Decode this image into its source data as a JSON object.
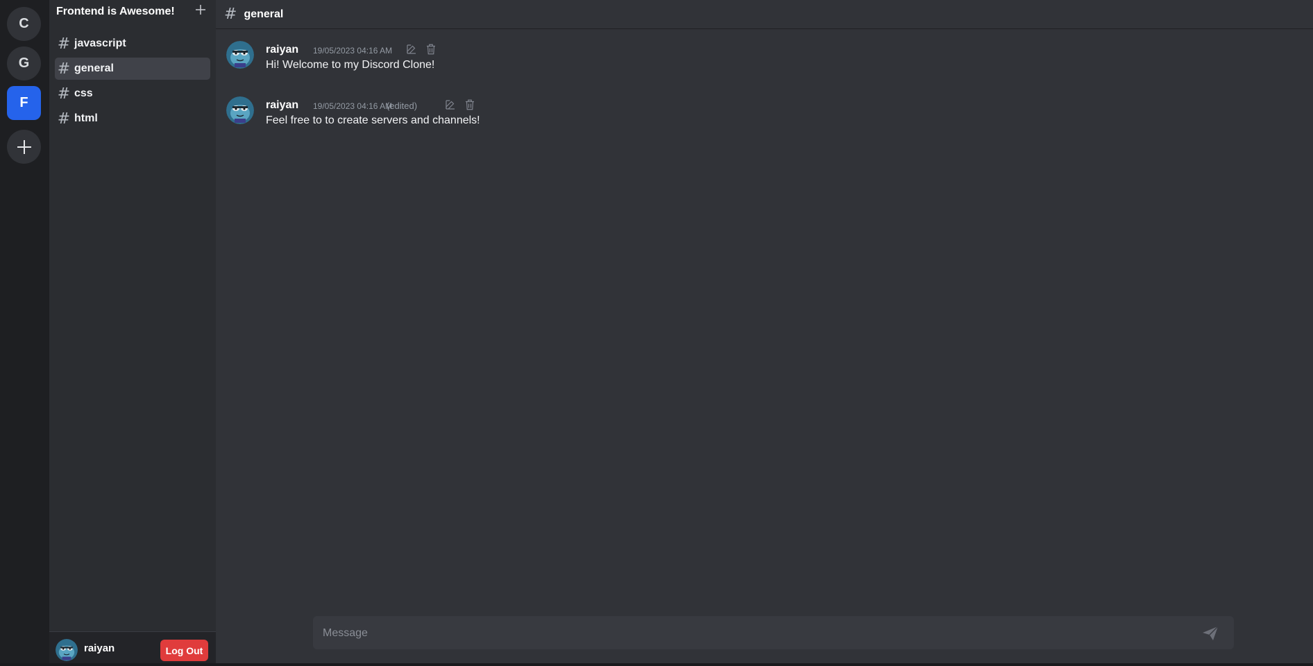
{
  "servers": [
    {
      "initial": "C"
    },
    {
      "initial": "G"
    },
    {
      "initial": "F",
      "active": true
    }
  ],
  "server": {
    "name": "Frontend is Awesome!"
  },
  "channels": [
    {
      "name": "javascript"
    },
    {
      "name": "general",
      "active": true
    },
    {
      "name": "css"
    },
    {
      "name": "html"
    }
  ],
  "header": {
    "hash": "#",
    "channel": "general"
  },
  "messages": [
    {
      "author": "raiyan",
      "time": "19/05/2023 04:16 AM",
      "edited": "",
      "text": "Hi! Welcome to my Discord Clone!"
    },
    {
      "author": "raiyan",
      "time": "19/05/2023 04:16 AM",
      "edited": "(edited)",
      "text": "Feel free to to create servers and channels!"
    }
  ],
  "composer": {
    "placeholder": "Message"
  },
  "user": {
    "name": "raiyan",
    "logout_label": "Log Out"
  },
  "colors": {
    "accent": "#2563eb",
    "danger": "#e03c3c",
    "bg_main": "#313338",
    "bg_sidebar": "#2b2d31",
    "bg_rail": "#1e1f22"
  },
  "icons": {
    "add_server": "plus-icon",
    "add_channel": "plus-icon",
    "edit": "pencil-icon",
    "delete": "trash-icon",
    "send": "paper-plane-icon",
    "channel": "hash-icon"
  }
}
